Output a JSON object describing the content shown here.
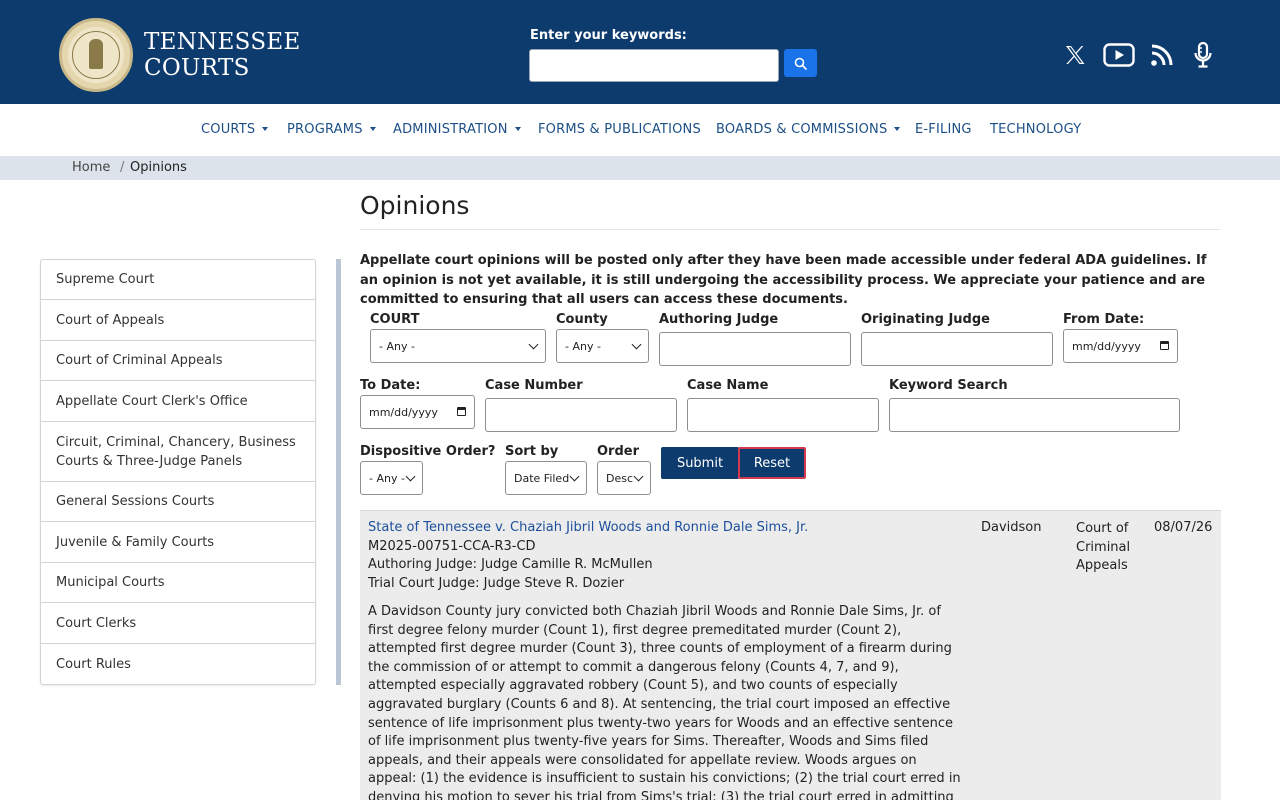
{
  "header": {
    "brand_line1": "TENNESSEE",
    "brand_line2": "COURTS",
    "search_label": "Enter your keywords:",
    "search_placeholder": "",
    "social": [
      "x-icon",
      "youtube-icon",
      "rss-icon",
      "podcast-icon"
    ]
  },
  "nav": {
    "items": [
      {
        "label": "COURTS",
        "dropdown": true
      },
      {
        "label": "PROGRAMS",
        "dropdown": true
      },
      {
        "label": "ADMINISTRATION",
        "dropdown": true
      },
      {
        "label": "FORMS & PUBLICATIONS",
        "dropdown": false
      },
      {
        "label": "BOARDS & COMMISSIONS",
        "dropdown": true
      },
      {
        "label": "E-FILING",
        "dropdown": false
      },
      {
        "label": "TECHNOLOGY",
        "dropdown": false
      }
    ]
  },
  "breadcrumb": {
    "home": "Home",
    "separator": "/",
    "current": "Opinions"
  },
  "sidebar": {
    "items": [
      {
        "label": "Supreme Court"
      },
      {
        "label": "Court of Appeals"
      },
      {
        "label": "Court of Criminal Appeals"
      },
      {
        "label": "Appellate Court Clerk's Office"
      },
      {
        "label": "Circuit, Criminal, Chancery, Business Courts & Three-Judge Panels"
      },
      {
        "label": "General Sessions Courts"
      },
      {
        "label": "Juvenile & Family Courts"
      },
      {
        "label": "Municipal Courts"
      },
      {
        "label": "Court Clerks"
      },
      {
        "label": "Court Rules"
      }
    ]
  },
  "main": {
    "title": "Opinions",
    "notice": "Appellate court opinions will be posted only after they have been made accessible under federal ADA guidelines. If an opinion is not yet available, it is still undergoing the accessibility process. We appreciate your patience and are committed to ensuring that all users can access these documents."
  },
  "filters": {
    "court_label": "COURT",
    "court_value": "- Any -",
    "county_label": "County",
    "county_value": "- Any -",
    "authoring_judge_label": "Authoring Judge",
    "originating_judge_label": "Originating Judge",
    "from_date_label": "From Date:",
    "from_date_value": "mm/dd/yyyy",
    "to_date_label": "To Date:",
    "to_date_value": "mm/dd/yyyy",
    "case_number_label": "Case Number",
    "case_name_label": "Case Name",
    "keyword_label": "Keyword Search",
    "dispositive_label": "Dispositive Order?",
    "dispositive_value": "- Any -",
    "sort_label": "Sort by",
    "sort_value": "Date Filed",
    "order_label": "Order",
    "order_value": "Desc",
    "submit_label": "Submit",
    "reset_label": "Reset"
  },
  "results": [
    {
      "title": "State of Tennessee v. Chaziah Jibril Woods and Ronnie Dale Sims, Jr.",
      "case_number": "M2025-00751-CCA-R3-CD",
      "authoring_judge": "Authoring Judge: Judge Camille R. McMullen",
      "trial_judge": "Trial Court Judge: Judge Steve R. Dozier",
      "county": "Davidson",
      "court": "Court of Criminal Appeals",
      "date": "08/07/26",
      "summary": "A Davidson County jury convicted both Chaziah Jibril Woods and Ronnie Dale Sims, Jr. of first degree felony murder (Count 1), first degree premeditated murder (Count 2), attempted first degree murder (Count 3), three counts of employment of a firearm during the commission of or attempt to commit a dangerous felony (Counts 4, 7, and 9), attempted especially aggravated robbery (Count 5), and two counts of especially aggravated burglary (Counts 6 and 8). At sentencing, the trial court imposed an effective sentence of life imprisonment plus twenty-two years for Woods and an effective sentence of life imprisonment plus twenty-five years for Sims. Thereafter, Woods and Sims filed appeals, and their appeals were consolidated for appellate review. Woods argues on appeal: (1) the evidence is insufficient to sustain his convictions; (2) the trial court erred in denying his motion to sever his trial from Sims's trial; (3) the trial court erred in admitting"
    }
  ],
  "colors": {
    "header_bg": "#0e3b6e",
    "nav_text": "#1c4f86",
    "link": "#1c4f9c",
    "search_btn": "#1a73e8",
    "reset_border": "#d23a4f"
  }
}
